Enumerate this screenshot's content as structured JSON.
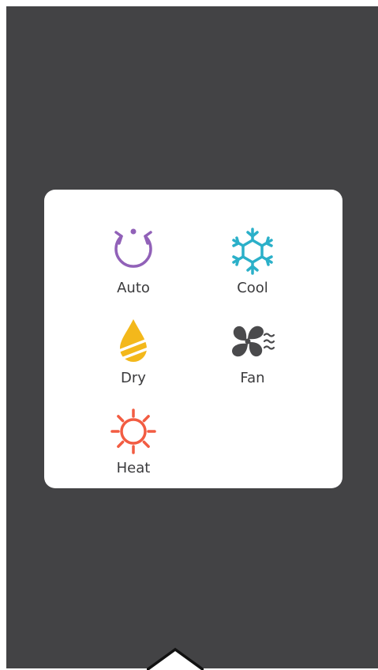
{
  "mode_selector": {
    "options": [
      {
        "label": "Auto",
        "icon": "auto-cycle-icon",
        "color": "#9161b8"
      },
      {
        "label": "Cool",
        "icon": "snowflake-icon",
        "color": "#2bb0c9"
      },
      {
        "label": "Dry",
        "icon": "water-drop-icon",
        "color": "#f3b81b"
      },
      {
        "label": "Fan",
        "icon": "fan-icon",
        "color": "#4a4a4c"
      },
      {
        "label": "Heat",
        "icon": "sun-icon",
        "color": "#f25c42"
      }
    ]
  },
  "colors": {
    "background": "#434345",
    "card": "#ffffff",
    "text": "#3a3a3c"
  }
}
